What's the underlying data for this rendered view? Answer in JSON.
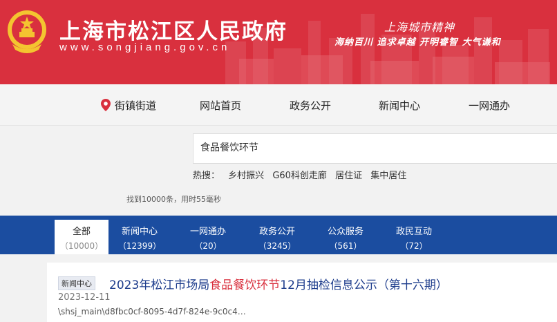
{
  "header": {
    "site_title": "上海市松江区人民政府",
    "site_url": "www.songjiang.gov.cn",
    "spirit_title": "上海城市精神",
    "spirit_slogan": "海纳百川  追求卓越  开明睿智  大气谦和",
    "brand_color": "#d9303e"
  },
  "nav": {
    "items": [
      {
        "label": "街镇街道",
        "icon": "location-pin-icon"
      },
      {
        "label": "网站首页"
      },
      {
        "label": "政务公开"
      },
      {
        "label": "新闻中心"
      },
      {
        "label": "一网通办"
      }
    ]
  },
  "search": {
    "value": "食品餐饮环节",
    "hot_label": "热搜：",
    "hot_links": [
      "乡村振兴",
      "G60科创走廊",
      "居住证",
      "集中居住"
    ],
    "stat": "找到10000条，用时55毫秒"
  },
  "tabs": {
    "accent_color": "#1b4da0",
    "items": [
      {
        "label": "全部",
        "count": "（10000）",
        "active": true
      },
      {
        "label": "新闻中心",
        "count": "（12399）"
      },
      {
        "label": "一网通办",
        "count": "（20）"
      },
      {
        "label": "政务公开",
        "count": "（3245）"
      },
      {
        "label": "公众服务",
        "count": "（561）"
      },
      {
        "label": "政民互动",
        "count": "（72）"
      }
    ]
  },
  "results": [
    {
      "badge": "新闻中心",
      "title_pre": "2023年松江市场局",
      "title_hl": "食品餐饮环节",
      "title_post": "12月抽检信息公示（第十六期）",
      "date": "2023-12-11",
      "path": "\\shsj_main\\d8fbc0cf-8095-4d7f-824e-9c0c4…"
    }
  ]
}
